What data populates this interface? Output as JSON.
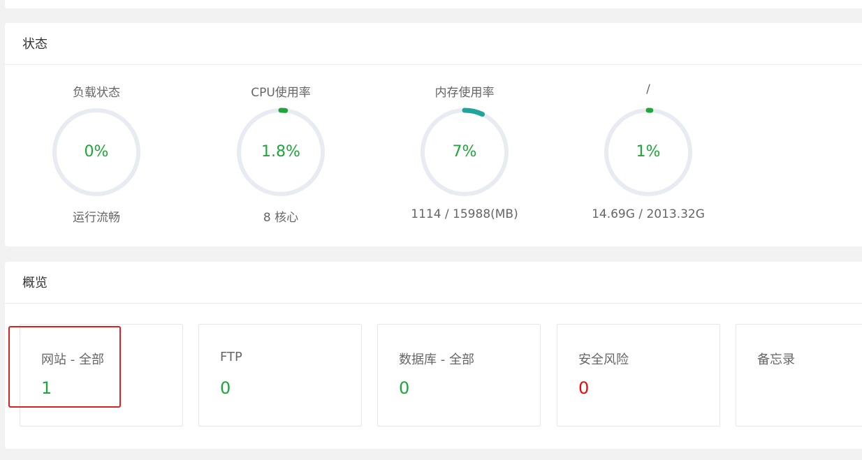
{
  "status": {
    "title": "状态",
    "gauges": [
      {
        "title": "负载状态",
        "value": "0%",
        "sub": "运行流畅",
        "percent": 0
      },
      {
        "title": "CPU使用率",
        "value": "1.8%",
        "sub": "8 核心",
        "percent": 1.8
      },
      {
        "title": "内存使用率",
        "value": "7%",
        "sub": "1114 / 15988(MB)",
        "percent": 7
      },
      {
        "title": "/",
        "value": "1%",
        "sub": "14.69G / 2013.32G",
        "percent": 1
      }
    ]
  },
  "overview": {
    "title": "概览",
    "cards": [
      {
        "title": "网站 - 全部",
        "value": "1",
        "status": "normal"
      },
      {
        "title": "FTP",
        "value": "0",
        "status": "normal"
      },
      {
        "title": "数据库 - 全部",
        "value": "0",
        "status": "normal"
      },
      {
        "title": "安全风险",
        "value": "0",
        "status": "danger"
      },
      {
        "title": "备忘录",
        "value": "",
        "status": "normal"
      }
    ]
  },
  "colors": {
    "accent_green": "#20a53a",
    "memory_teal": "#20a59c",
    "danger_red": "#ef0808",
    "ring_track": "#e8ebf2",
    "highlight": "#e02020"
  }
}
